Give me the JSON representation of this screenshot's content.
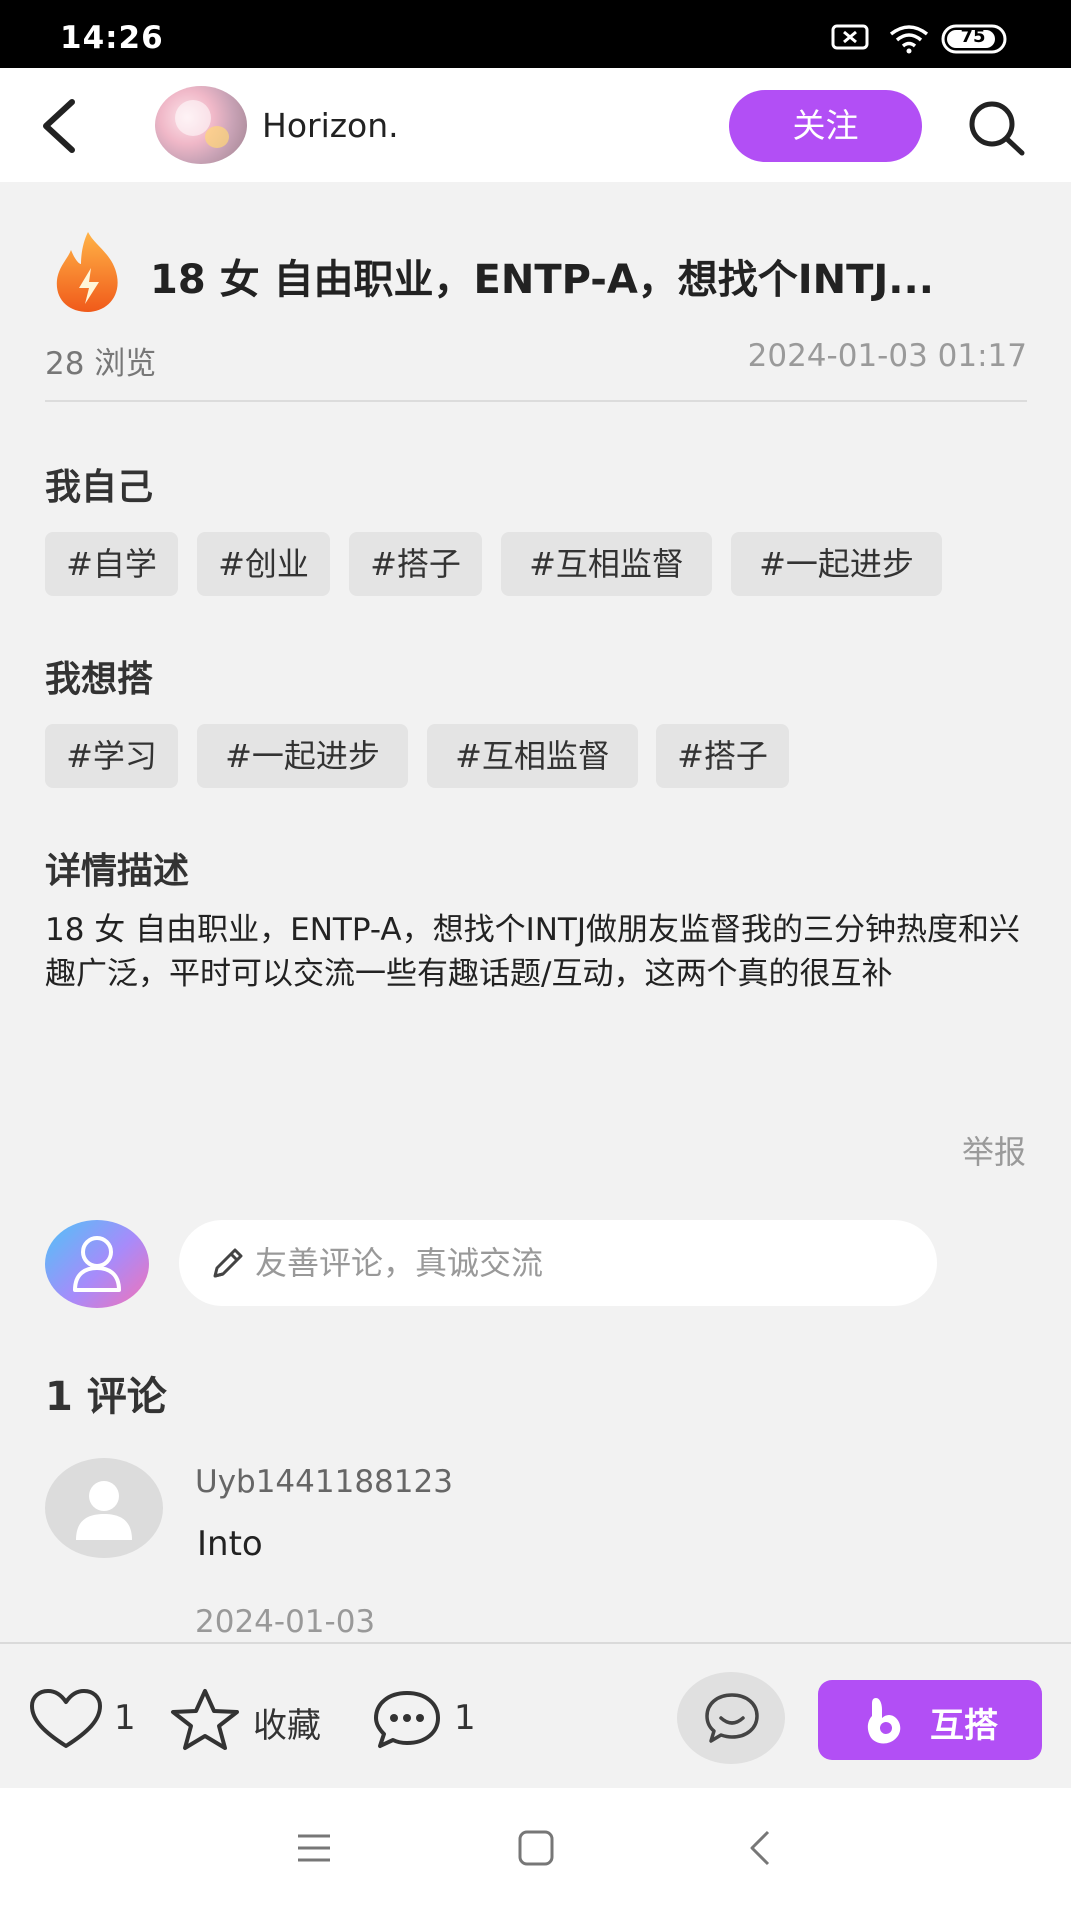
{
  "status_bar": {
    "time": "14:26",
    "battery": "75"
  },
  "header": {
    "username": "Horizon.",
    "follow_label": "关注",
    "back_icon": "chevron-left-icon",
    "search_icon": "search-icon"
  },
  "post": {
    "title": "18 女 自由职业，ENTP-A，想找个INTJ...",
    "views": "28 浏览",
    "date": "2024-01-03 01:17",
    "myself_title": "我自己",
    "myself_tags": [
      "#自学",
      "#创业",
      "#搭子",
      "#互相监督",
      "#一起进步"
    ],
    "want_title": "我想搭",
    "want_tags": [
      "#学习",
      "#一起进步",
      "#互相监督",
      "#搭子"
    ],
    "detail_title": "详情描述",
    "description": "18 女 自由职业，ENTP-A，想找个INTJ做朋友监督我的三分钟热度和兴趣广泛，平时可以交流一些有趣话题/互动，这两个真的很互补",
    "report_label": "举报"
  },
  "comment_box": {
    "placeholder": "友善评论，真诚交流"
  },
  "comments": {
    "count_label": "1 评论",
    "items": [
      {
        "user": "Uyb1441188123",
        "text": "Into",
        "date": "2024-01-03"
      }
    ]
  },
  "bottom_bar": {
    "like_count": "1",
    "favorite_label": "收藏",
    "comment_count": "1",
    "pair_label": "互搭"
  },
  "colors": {
    "accent": "#b24ff5",
    "background": "#f2f2f2"
  }
}
